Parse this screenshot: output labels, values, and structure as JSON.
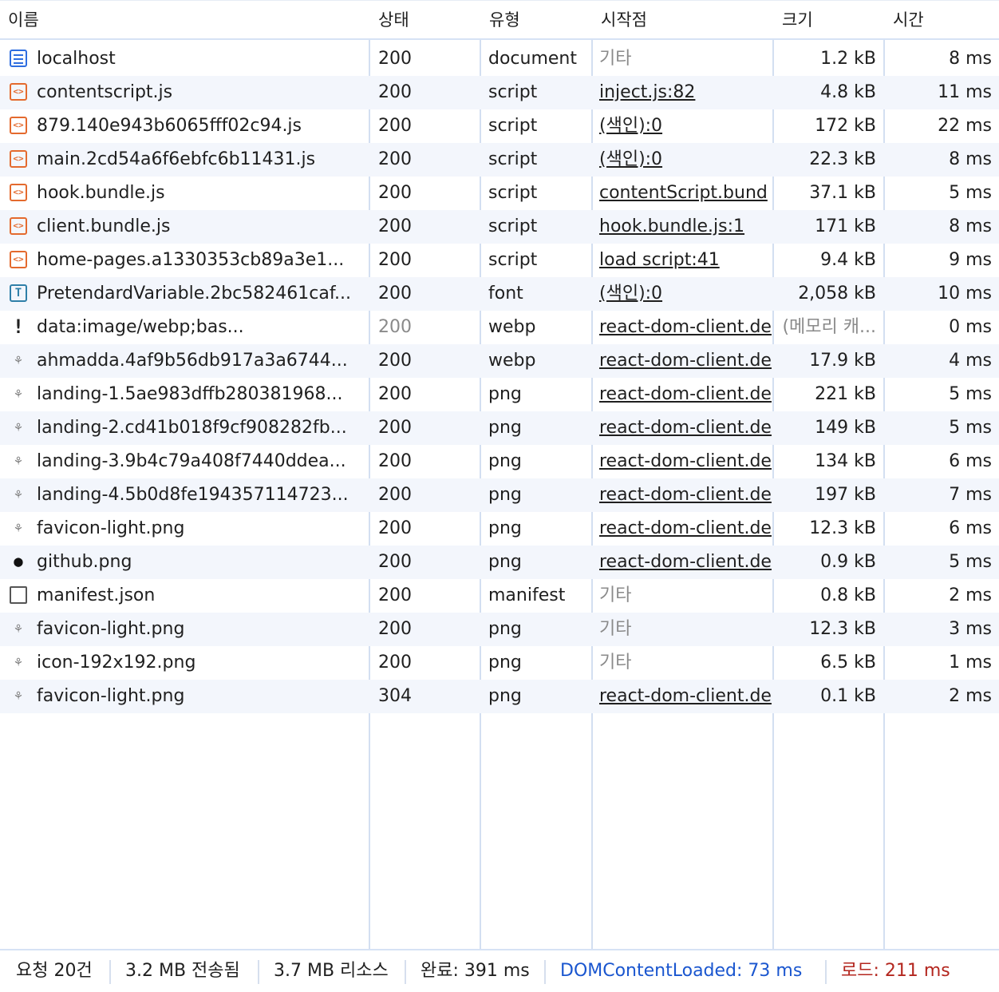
{
  "columns": {
    "name": "이름",
    "status": "상태",
    "type": "유형",
    "initiator": "시작점",
    "size": "크기",
    "time": "시간"
  },
  "rows": [
    {
      "icon": "document-icon",
      "name": "localhost",
      "status": "200",
      "type": "document",
      "initiator": "기타",
      "initiator_link": false,
      "size": "1.2 kB",
      "time": "8 ms"
    },
    {
      "icon": "script-icon",
      "name": "contentscript.js",
      "status": "200",
      "type": "script",
      "initiator": "inject.js:82",
      "initiator_link": true,
      "size": "4.8 kB",
      "time": "11 ms"
    },
    {
      "icon": "script-icon",
      "name": "879.140e943b6065fff02c94.js",
      "status": "200",
      "type": "script",
      "initiator": "(색인):0",
      "initiator_link": true,
      "size": "172 kB",
      "time": "22 ms"
    },
    {
      "icon": "script-icon",
      "name": "main.2cd54a6f6ebfc6b11431.js",
      "status": "200",
      "type": "script",
      "initiator": "(색인):0",
      "initiator_link": true,
      "size": "22.3 kB",
      "time": "8 ms"
    },
    {
      "icon": "script-icon",
      "name": "hook.bundle.js",
      "status": "200",
      "type": "script",
      "initiator": "contentScript.bund",
      "initiator_link": true,
      "size": "37.1 kB",
      "time": "5 ms"
    },
    {
      "icon": "script-icon",
      "name": "client.bundle.js",
      "status": "200",
      "type": "script",
      "initiator": "hook.bundle.js:1",
      "initiator_link": true,
      "size": "171 kB",
      "time": "8 ms"
    },
    {
      "icon": "script-icon",
      "name": "home-pages.a1330353cb89a3e1...",
      "status": "200",
      "type": "script",
      "initiator": "load script:41",
      "initiator_link": true,
      "size": "9.4 kB",
      "time": "9 ms"
    },
    {
      "icon": "font-icon",
      "name": "PretendardVariable.2bc582461caf...",
      "status": "200",
      "type": "font",
      "initiator": "(색인):0",
      "initiator_link": true,
      "size": "2,058 kB",
      "time": "10 ms"
    },
    {
      "icon": "warning-icon",
      "name": "data:image/webp;bas...",
      "status": "200",
      "status_gray": true,
      "type": "webp",
      "initiator": "react-dom-client.de",
      "initiator_link": true,
      "size": "(메모리 캐...",
      "size_gray": true,
      "time": "0 ms"
    },
    {
      "icon": "image-thumbnail-icon",
      "name": "ahmadda.4af9b56db917a3a6744...",
      "status": "200",
      "type": "webp",
      "initiator": "react-dom-client.de",
      "initiator_link": true,
      "size": "17.9 kB",
      "time": "4 ms"
    },
    {
      "icon": "image-thumbnail-icon",
      "name": "landing-1.5ae983dffb280381968...",
      "status": "200",
      "type": "png",
      "initiator": "react-dom-client.de",
      "initiator_link": true,
      "size": "221 kB",
      "time": "5 ms"
    },
    {
      "icon": "image-thumbnail-icon",
      "name": "landing-2.cd41b018f9cf908282fb...",
      "status": "200",
      "type": "png",
      "initiator": "react-dom-client.de",
      "initiator_link": true,
      "size": "149 kB",
      "time": "5 ms"
    },
    {
      "icon": "image-thumbnail-icon",
      "name": "landing-3.9b4c79a408f7440ddea...",
      "status": "200",
      "type": "png",
      "initiator": "react-dom-client.de",
      "initiator_link": true,
      "size": "134 kB",
      "time": "6 ms"
    },
    {
      "icon": "image-thumbnail-icon",
      "name": "landing-4.5b0d8fe194357114723...",
      "status": "200",
      "type": "png",
      "initiator": "react-dom-client.de",
      "initiator_link": true,
      "size": "197 kB",
      "time": "7 ms"
    },
    {
      "icon": "image-thumbnail-icon",
      "name": "favicon-light.png",
      "status": "200",
      "type": "png",
      "initiator": "react-dom-client.de",
      "initiator_link": true,
      "size": "12.3 kB",
      "time": "6 ms"
    },
    {
      "icon": "github-icon",
      "name": "github.png",
      "status": "200",
      "type": "png",
      "initiator": "react-dom-client.de",
      "initiator_link": true,
      "size": "0.9 kB",
      "time": "5 ms"
    },
    {
      "icon": "manifest-icon",
      "name": "manifest.json",
      "status": "200",
      "type": "manifest",
      "initiator": "기타",
      "initiator_link": false,
      "size": "0.8 kB",
      "time": "2 ms"
    },
    {
      "icon": "image-thumbnail-icon",
      "name": "favicon-light.png",
      "status": "200",
      "type": "png",
      "initiator": "기타",
      "initiator_link": false,
      "size": "12.3 kB",
      "time": "3 ms"
    },
    {
      "icon": "image-thumbnail-icon",
      "name": "icon-192x192.png",
      "status": "200",
      "type": "png",
      "initiator": "기타",
      "initiator_link": false,
      "size": "6.5 kB",
      "time": "1 ms"
    },
    {
      "icon": "image-thumbnail-icon",
      "name": "favicon-light.png",
      "status": "304",
      "type": "png",
      "initiator": "react-dom-client.de",
      "initiator_link": true,
      "size": "0.1 kB",
      "time": "2 ms"
    }
  ],
  "footer": {
    "requests": "요청 20건",
    "transferred": "3.2 MB 전송됨",
    "resources": "3.7 MB 리소스",
    "finish": "완료: 391 ms",
    "dom_content_loaded": "DOMContentLoaded: 73 ms",
    "load": "로드: 211 ms"
  },
  "colors": {
    "dcl": "#1a56cf",
    "load": "#b3261e",
    "script_icon": "#e46a2e",
    "document_icon": "#2f6ee0"
  }
}
